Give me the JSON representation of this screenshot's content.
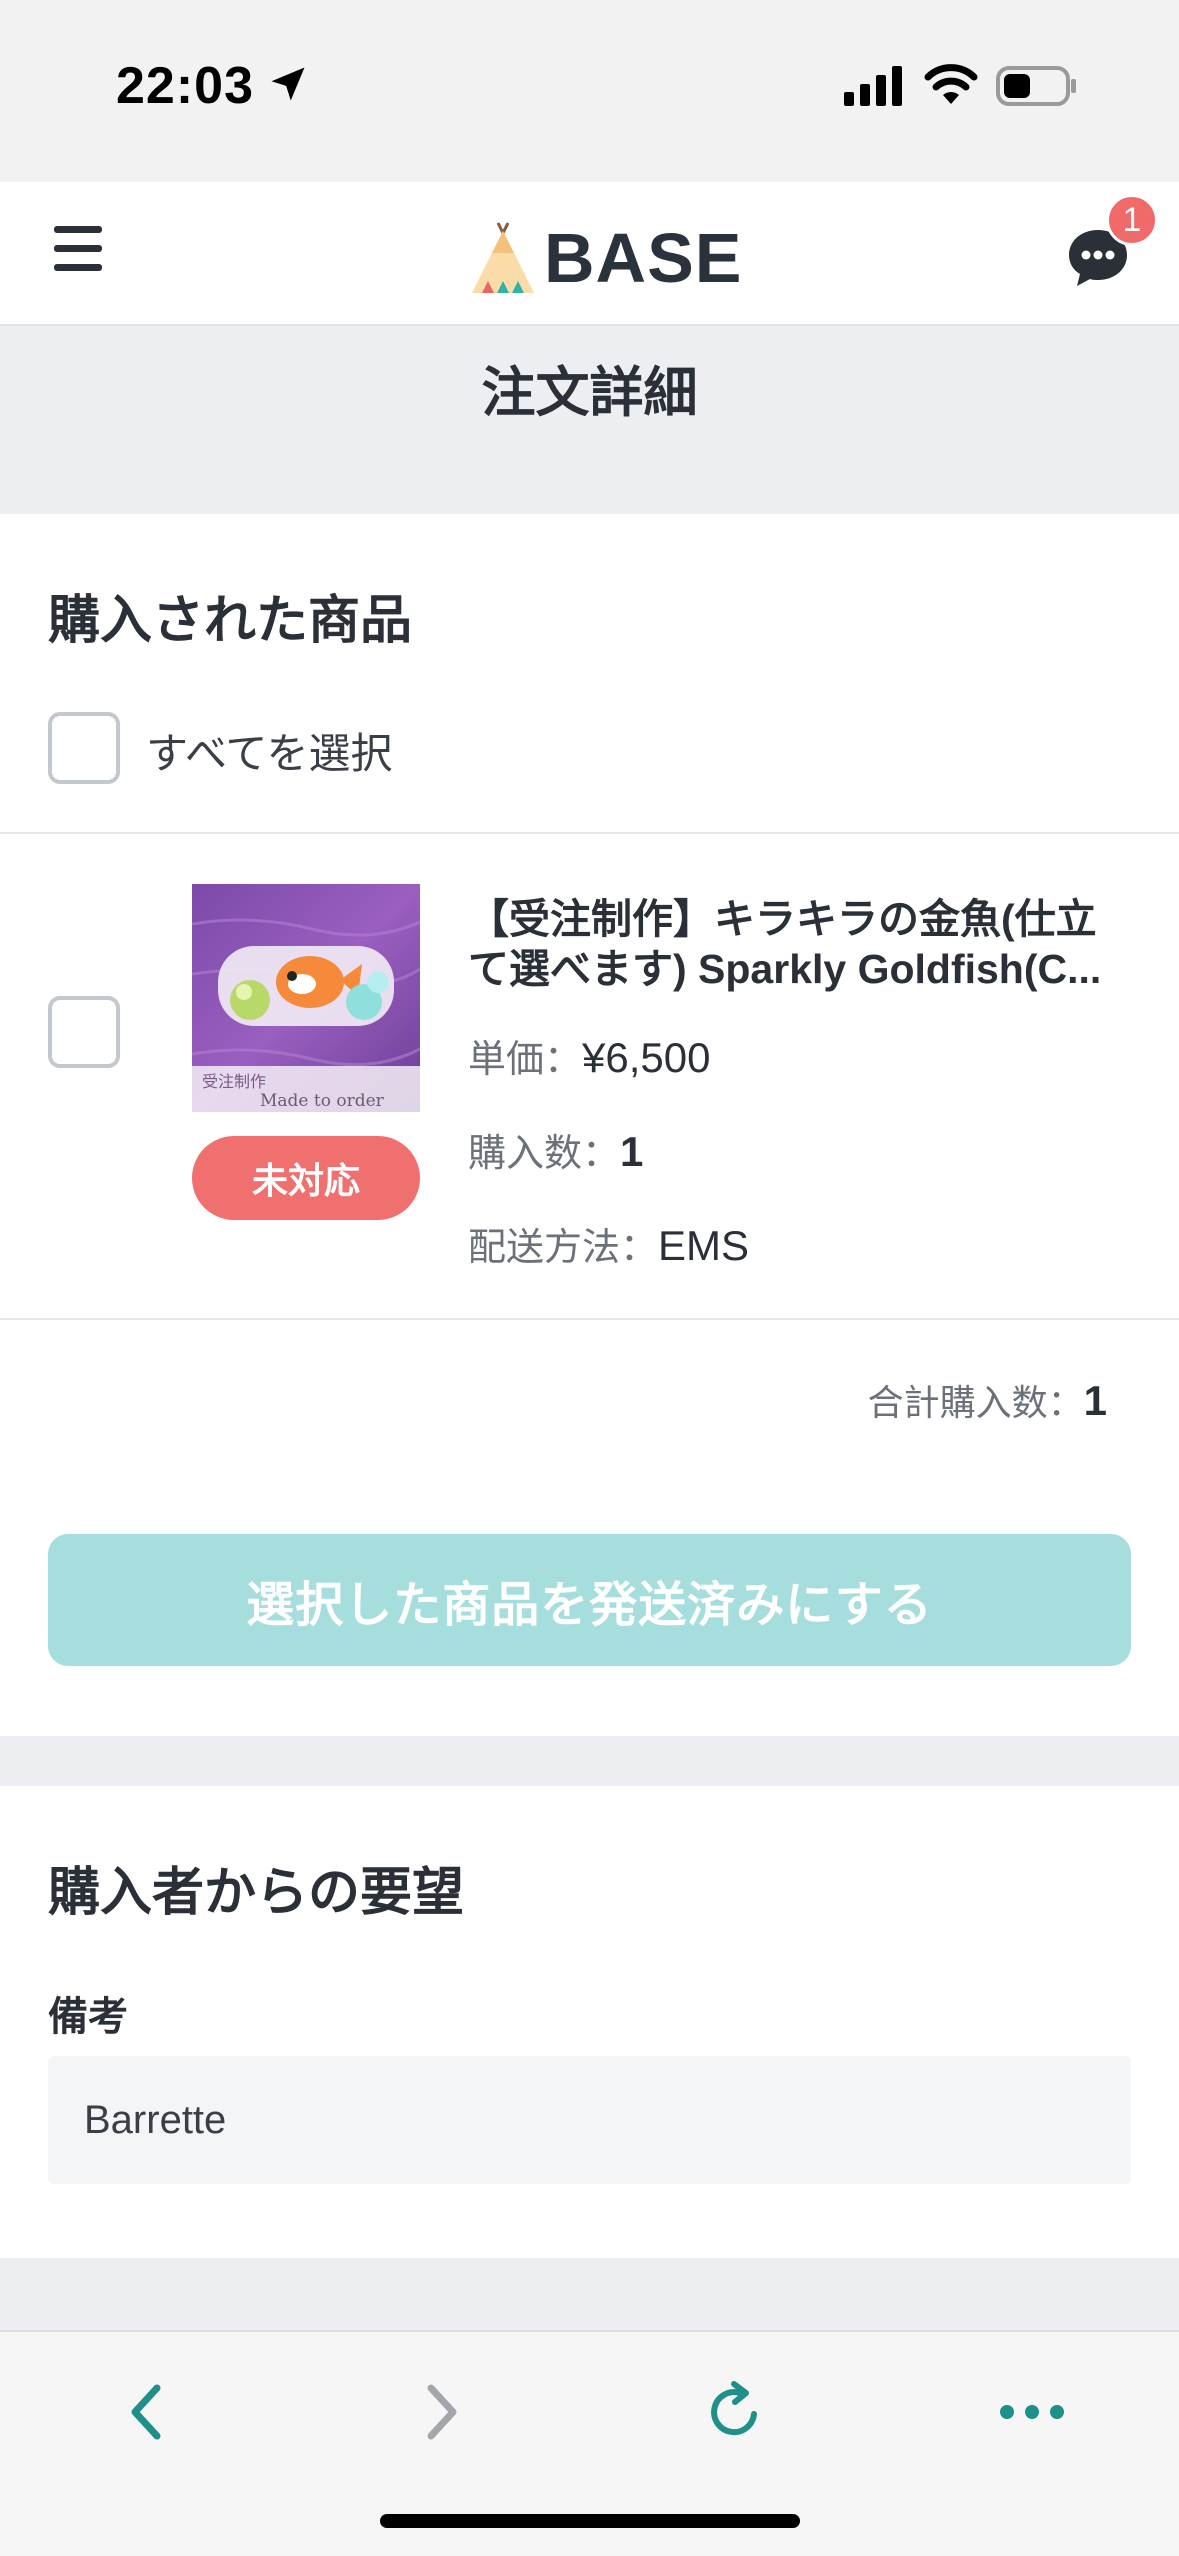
{
  "status_bar": {
    "time": "22:03"
  },
  "header": {
    "logo_text": "BASE",
    "chat_badge_count": "1"
  },
  "page": {
    "title": "注文詳細"
  },
  "purchased": {
    "heading": "購入された商品",
    "select_all_label": "すべてを選択",
    "item": {
      "name_line1": "【受注制作】キラキラの金魚(仕立",
      "name_line2": "て選べます) Sparkly Goldfish(C...",
      "status": "未対応",
      "unit_price_label": "単価：",
      "unit_price_value": "¥6,500",
      "quantity_label": "購入数：",
      "quantity_value": "1",
      "shipping_label": "配送方法：",
      "shipping_value": "EMS",
      "image_caption_1": "受注制作",
      "image_caption_2": "Made to order"
    },
    "total_label": "合計購入数：",
    "total_value": "1",
    "ship_button_label": "選択した商品を発送済みにする"
  },
  "request": {
    "heading": "購入者からの要望",
    "remarks_label": "備考",
    "remarks_value": "Barrette"
  },
  "colors": {
    "accent_teal": "#a6dedd",
    "status_red": "#f07070",
    "badge_red": "#f16a6a",
    "toolbar_icon": "#1f8f8a"
  }
}
